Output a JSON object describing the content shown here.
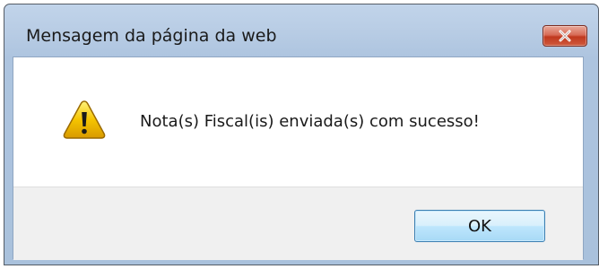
{
  "dialog": {
    "title": "Mensagem da página da web",
    "message": "Nota(s) Fiscal(is) enviada(s) com sucesso!",
    "ok_label": "OK",
    "close_icon": "close-icon",
    "message_icon": "warning-icon"
  },
  "colors": {
    "title_bar": "#b9cde5",
    "content_bg": "#ffffff",
    "footer_bg": "#f0f0f0",
    "close_button": "#c0391f",
    "ok_button_border": "#3c7fb1",
    "warning_fill": "#f5c400"
  }
}
